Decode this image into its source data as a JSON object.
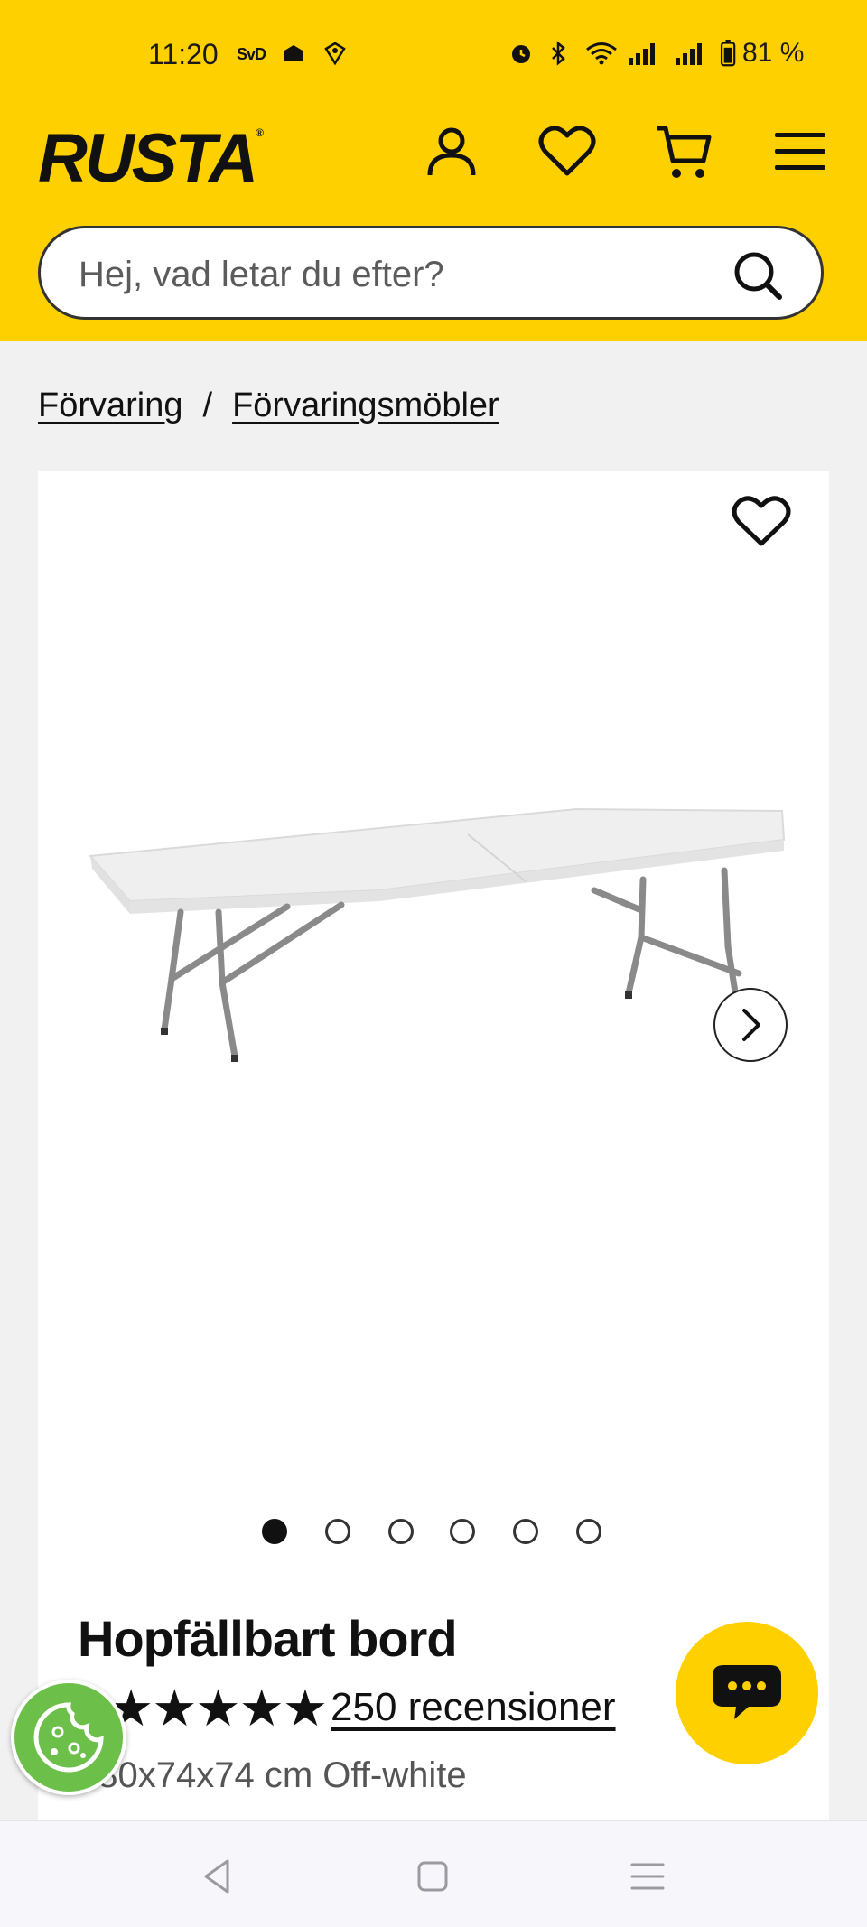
{
  "status_bar": {
    "time": "11:20",
    "svd": "SvD",
    "battery": "81 %"
  },
  "header": {
    "logo": "RUSTA",
    "logo_mark": "®",
    "search_placeholder": "Hej, vad letar du efter?"
  },
  "breadcrumb": {
    "items": [
      "Förvaring",
      "Förvaringsmöbler"
    ],
    "separator": "/"
  },
  "product": {
    "title": "Hopfällbart bord",
    "rating_stars": "★★★★★",
    "rating": 5,
    "reviews": "250 recensioner",
    "subtitle": "180x74x74 cm Off-white",
    "image_count": 6,
    "active_image": 1
  },
  "colors": {
    "brand_yellow": "#ffd000",
    "cookie_green": "#6cc04a"
  }
}
